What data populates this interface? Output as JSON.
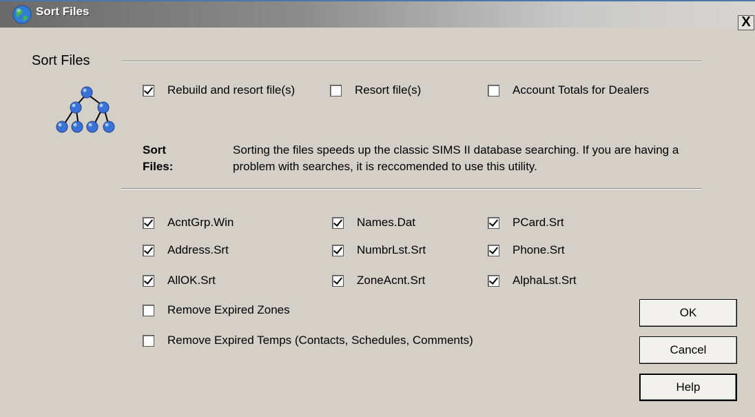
{
  "window": {
    "title": "Sort Files",
    "close_label": "X"
  },
  "group": {
    "title": "Sort Files"
  },
  "modes": [
    {
      "label": "Rebuild and resort file(s)",
      "checked": true
    },
    {
      "label": "Resort file(s)",
      "checked": false
    },
    {
      "label": "Account Totals for Dealers",
      "checked": false
    }
  ],
  "description": {
    "label": "Sort Files:",
    "text": "Sorting the files speeds up the classic SIMS II database searching. If you are having a problem with searches, it is reccomended to use this utility."
  },
  "files": [
    {
      "label": "AcntGrp.Win",
      "checked": true
    },
    {
      "label": "Names.Dat",
      "checked": true
    },
    {
      "label": "PCard.Srt",
      "checked": true
    },
    {
      "label": "Address.Srt",
      "checked": true
    },
    {
      "label": "NumbrLst.Srt",
      "checked": true
    },
    {
      "label": "Phone.Srt",
      "checked": true
    },
    {
      "label": "AllOK.Srt",
      "checked": true
    },
    {
      "label": "ZoneAcnt.Srt",
      "checked": true
    },
    {
      "label": "AlphaLst.Srt",
      "checked": true
    }
  ],
  "options": [
    {
      "label": "Remove Expired Zones",
      "checked": false
    },
    {
      "label": "Remove Expired Temps (Contacts, Schedules, Comments)",
      "checked": false
    }
  ],
  "buttons": {
    "ok": "OK",
    "cancel": "Cancel",
    "help": "Help"
  },
  "colors": {
    "dialog_bg": "#d4d0c8",
    "node_blue": "#3a72d8"
  },
  "icons": {
    "title": "globe-icon",
    "group": "tree-hierarchy-icon",
    "close": "close-icon"
  }
}
